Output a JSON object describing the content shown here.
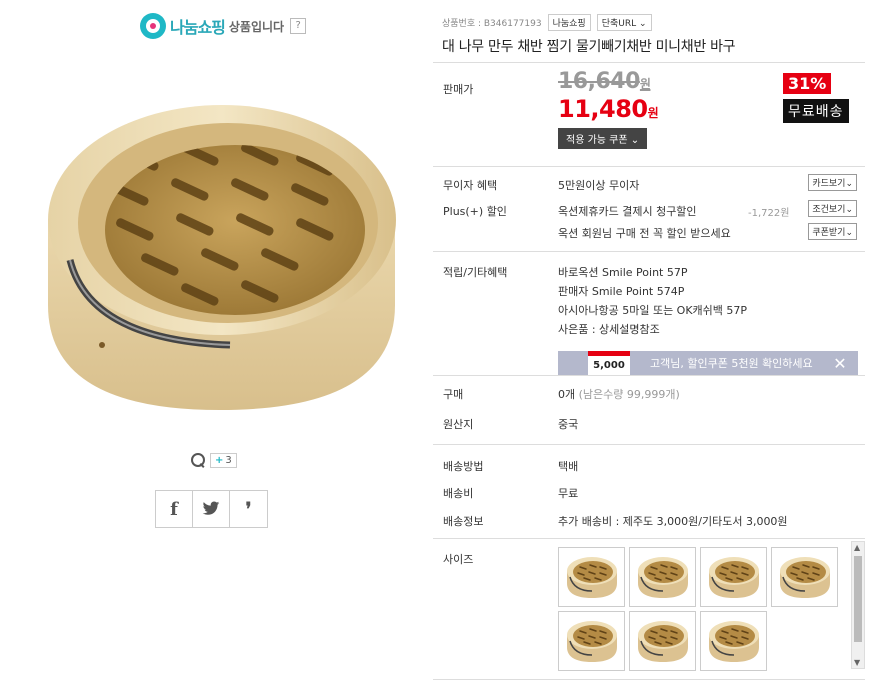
{
  "seller": {
    "name": "나눔쇼핑",
    "suffix": "상품입니다",
    "help": "?"
  },
  "gallery": {
    "more_count": "3",
    "share": [
      "f",
      "twitter",
      "❜"
    ]
  },
  "header": {
    "product_no": "상품번호 : B346177193",
    "brand": "나눔쇼핑",
    "url_label": "단축URL",
    "title": "대 나무 만두 채반 찜기 물기빼기채반 미니채반 바구"
  },
  "price": {
    "label": "판매가",
    "original": "16,640",
    "current": "11,480",
    "unit": "원",
    "discount": "31%",
    "free_shipping": "무료배송",
    "coupon_button": "적용 가능 쿠폰"
  },
  "benefits": {
    "installment_label": "무이자 혜택",
    "installment_value": "5만원이상 무이자",
    "card_button": "카드보기",
    "plus_label": "Plus(+) 할인",
    "plus_value": "옥션제휴카드 결제시 청구할인",
    "plus_amount": "-1,722원",
    "condition_button": "조건보기",
    "member_value": "옥션 회원님 구매 전 꼭 할인 받으세요",
    "coupon_receive_button": "쿠폰받기"
  },
  "points": {
    "label": "적립/기타혜택",
    "lines": [
      "바로옥션 Smile Point 57P",
      "판매자 Smile Point 574P",
      "아시아나항공 5마일 또는 OK캐쉬백 57P",
      "사은품 : 상세설명참조"
    ],
    "banner_coupon": "5,000",
    "banner_text": "고객님, 할인쿠폰 5천원 확인하세요"
  },
  "purchase": {
    "label": "구매",
    "value": "0개",
    "remaining": "(남은수량 99,999개)",
    "origin_label": "원산지",
    "origin_value": "중국"
  },
  "shipping": {
    "method_label": "배송방법",
    "method_value": "택배",
    "fee_label": "배송비",
    "fee_value": "무료",
    "info_label": "배송정보",
    "info_value": "추가 배송비 : 제주도 3,000원/기타도서 3,000원"
  },
  "size": {
    "label": "사이즈",
    "thumbnail_count": 7
  },
  "colors": {
    "sale_red": "#e60012",
    "accent_teal": "#1fb8c6",
    "banner_bg": "#b4b8cc"
  }
}
